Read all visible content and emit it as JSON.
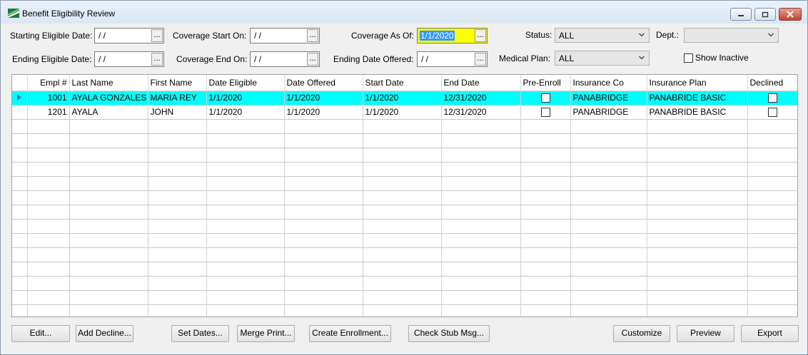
{
  "window": {
    "title": "Benefit Eligibility Review"
  },
  "filters": {
    "starting_eligible_date": {
      "label": "Starting Eligible Date:",
      "value": "/ /"
    },
    "ending_eligible_date": {
      "label": "Ending Eligible Date:",
      "value": "/ /"
    },
    "coverage_start_on": {
      "label": "Coverage Start On:",
      "value": "/ /"
    },
    "coverage_end_on": {
      "label": "Coverage End On:",
      "value": "/ /"
    },
    "coverage_as_of": {
      "label": "Coverage As Of:",
      "value": "1/1/2020"
    },
    "ending_date_offered": {
      "label": "Ending Date Offered:",
      "value": "/ /"
    },
    "status": {
      "label": "Status:",
      "value": "ALL"
    },
    "dept": {
      "label": "Dept.:",
      "value": ""
    },
    "medical_plan": {
      "label": "Medical Plan:",
      "value": "ALL"
    },
    "show_inactive": {
      "label": "Show Inactive",
      "checked": false
    },
    "ellipsis": "..."
  },
  "grid": {
    "columns": [
      "Empl #",
      "Last Name",
      "First Name",
      "Date Eligible",
      "Date Offered",
      "Start Date",
      "End Date",
      "Pre-Enroll",
      "Insurance Co",
      "Insurance Plan",
      "Declined"
    ],
    "rows": [
      {
        "empl": "1001",
        "last": "AYALA GONZALES",
        "first": "MARIA REY",
        "eligible": "1/1/2020",
        "offered": "1/1/2020",
        "start": "1/1/2020",
        "end": "12/31/2020",
        "pre_enroll": false,
        "ins_co": "PANABRIDGE",
        "ins_plan": "PANABRIDE BASIC",
        "declined": false,
        "selected": true
      },
      {
        "empl": "1201",
        "last": "AYALA",
        "first": "JOHN",
        "eligible": "1/1/2020",
        "offered": "1/1/2020",
        "start": "1/1/2020",
        "end": "12/31/2020",
        "pre_enroll": false,
        "ins_co": "PANABRIDGE",
        "ins_plan": "PANABRIDE BASIC",
        "declined": false,
        "selected": false
      }
    ]
  },
  "buttons": {
    "edit": "Edit...",
    "add_decline": "Add Decline...",
    "set_dates": "Set Dates...",
    "merge_print": "Merge Print...",
    "create_enrollment": "Create Enrollment...",
    "check_stub_msg": "Check Stub Msg...",
    "customize": "Customize",
    "preview": "Preview",
    "export": "Export"
  },
  "colors": {
    "selected_row": "#00ffff",
    "active_field": "#ffff00",
    "selection": "#3399ff"
  }
}
